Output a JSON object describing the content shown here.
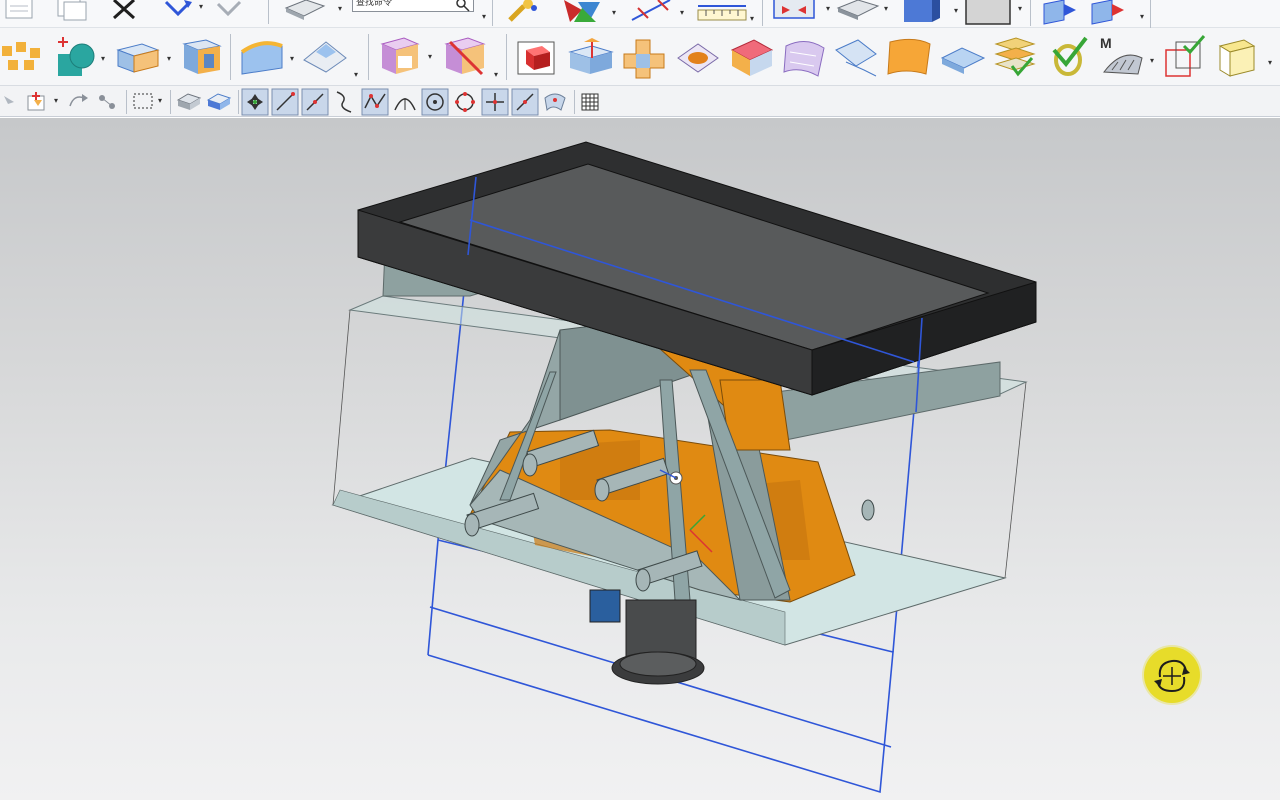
{
  "toolbar": {
    "search_placeholder": "查找命令",
    "accent_color": "#2f56d8",
    "row1_icons": [
      "new-file-icon",
      "copy-icon",
      "cut-icon",
      "undo-icon",
      "redo-icon",
      "view-icon",
      "search-icon",
      "tools-icon",
      "select-filter-icon",
      "measure-icon",
      "ruler-icon",
      "fit-view-icon",
      "render-mode-icon",
      "shaded-cube-icon",
      "background-icon",
      "datum-plane-icon",
      "section-view-icon"
    ],
    "row2_icons": [
      "pattern-feature-icon",
      "unite-icon",
      "extrude-icon",
      "hole-icon",
      "edge-blend-icon",
      "chamfer-icon",
      "shell-icon",
      "trim-body-icon",
      "box-icon",
      "split-body-icon",
      "offset-face-icon",
      "patch-icon",
      "replace-face-icon",
      "bounded-plane-icon",
      "ruled-surface-icon",
      "sew-icon",
      "surface-icon",
      "thicken-icon",
      "check-geometry-icon",
      "deviation-icon",
      "measure-body-icon",
      "analysis-icon",
      "design-check-icon",
      "wireframe-box-icon"
    ],
    "row3_icons": [
      "select-arrow-icon",
      "filter-icon",
      "relation-icon",
      "snap-icon",
      "rectangle-select-icon",
      "solid-icon",
      "face-icon",
      "endpoint-snap-icon",
      "line-snap-icon",
      "midpoint-snap-icon",
      "curve-snap-icon",
      "control-point-icon",
      "arc-center-icon",
      "circle-center-icon",
      "quadrant-icon",
      "intersection-icon",
      "tangent-icon",
      "surface-point-icon",
      "grid-icon"
    ]
  },
  "viewport": {
    "background_top": "#c6c8ca",
    "background_bottom": "#f1f1f2",
    "model": {
      "frame_color": "#2e2f30",
      "plate_color": "#cfe3e2",
      "body_color": "#8fa5a6",
      "cavity_color": "#e08a12",
      "bounding_box_color": "#2f56d8"
    },
    "rotate_indicator_icon": "rotate-view-icon"
  }
}
